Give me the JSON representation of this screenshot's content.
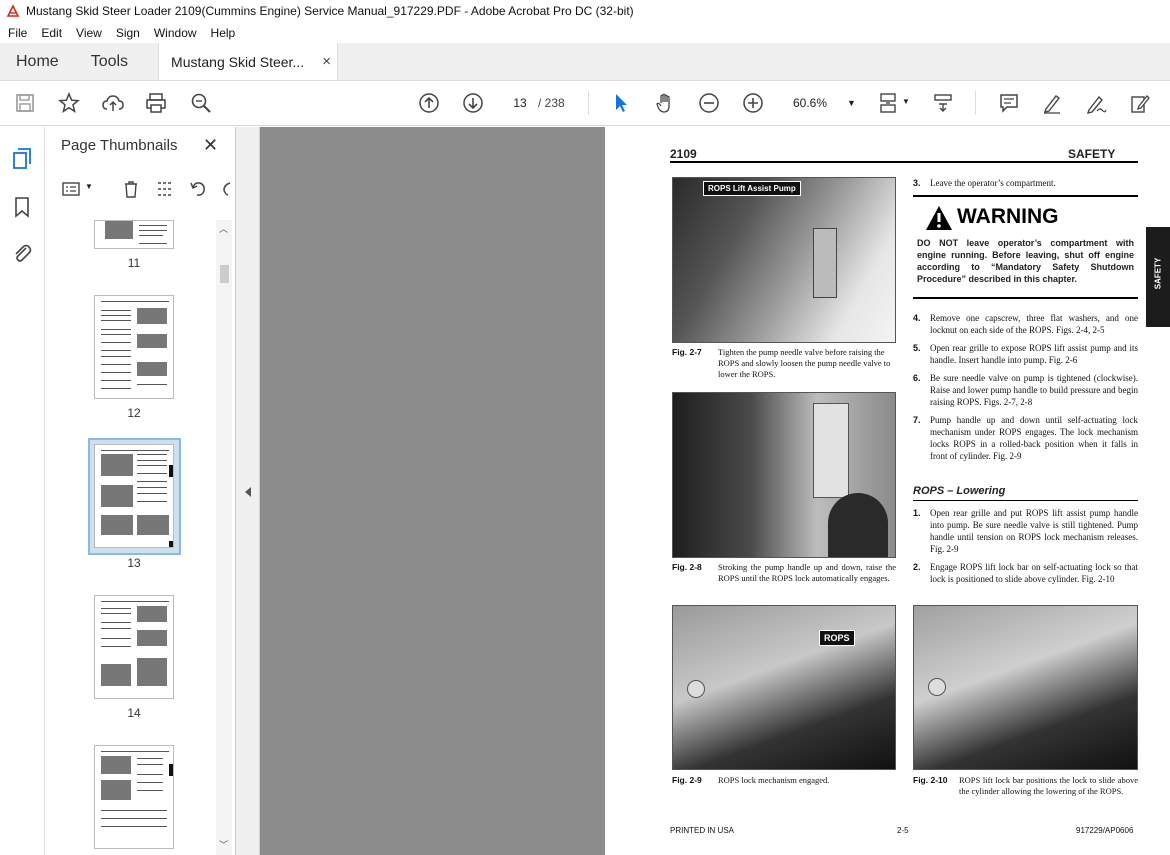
{
  "window": {
    "title": "Mustang Skid Steer Loader 2109(Cummins Engine) Service Manual_917229.PDF - Adobe Acrobat Pro DC (32-bit)"
  },
  "menu": [
    "File",
    "Edit",
    "View",
    "Sign",
    "Window",
    "Help"
  ],
  "tabs": {
    "home": "Home",
    "tools": "Tools",
    "document": "Mustang Skid Steer...",
    "close": "×"
  },
  "toolbar": {
    "page_current": "13",
    "page_total": "/ 238",
    "zoom": "60.6%"
  },
  "thumbnails": {
    "title": "Page Thumbnails",
    "close": "✕",
    "pages": [
      "11",
      "12",
      "13",
      "14"
    ],
    "selected": "13"
  },
  "document_page": {
    "header_left": "2109",
    "header_right": "SAFETY",
    "side_tab": "SAFETY",
    "fig7_label": "ROPS Lift Assist Pump",
    "fig7_caption_num": "Fig. 2-7",
    "fig7_caption": "Tighten the pump needle valve before raising the ROPS and slowly loosen the pump needle valve to lower the ROPS.",
    "fig8_caption_num": "Fig. 2-8",
    "fig8_caption": "Stroking the pump handle up and down, raise the ROPS until the ROPS lock automatically engages.",
    "fig9_label": "ROPS",
    "fig9_caption_num": "Fig. 2-9",
    "fig9_caption": "ROPS lock mechanism engaged.",
    "fig10_caption_num": "Fig. 2-10",
    "fig10_caption": "ROPS lift lock bar positions the lock to slide above the cylinder allowing the lowering of the ROPS.",
    "step3_num": "3.",
    "step3": "Leave the operator’s compartment.",
    "warning_title": "WARNING",
    "warning_text": "DO NOT leave operator’s compartment with engine running. Before leaving, shut off engine according to “Mandatory Safety Shutdown Procedure” described in this chapter.",
    "step4_num": "4.",
    "step4": "Remove one capscrew, three flat washers, and one locknut on each side of the ROPS. Figs. 2-4, 2-5",
    "step5_num": "5.",
    "step5": "Open rear grille to expose ROPS lift assist pump and its handle. Insert handle into pump. Fig. 2-6",
    "step6_num": "6.",
    "step6": "Be sure needle valve on pump is tightened (clockwise). Raise and lower pump handle to build pressure and begin raising ROPS. Figs. 2-7, 2-8",
    "step7_num": "7.",
    "step7": "Pump handle up and down until self-actuating lock mechanism under ROPS engages. The lock mechanism locks ROPS in a rolled-back position when it falls in front of cylinder. Fig. 2-9",
    "section_title": "ROPS – Lowering",
    "lower1_num": "1.",
    "lower1": "Open rear grille and put ROPS lift assist pump handle into pump. Be sure needle valve is still tightened. Pump handle until tension on ROPS lock mechanism releases. Fig. 2-9",
    "lower2_num": "2.",
    "lower2": "Engage ROPS lift lock bar on self-actuating lock so that lock is positioned to slide above cylinder. Fig. 2-10",
    "footer_left": "PRINTED IN USA",
    "footer_center": "2-5",
    "footer_right": "917229/AP0606"
  }
}
